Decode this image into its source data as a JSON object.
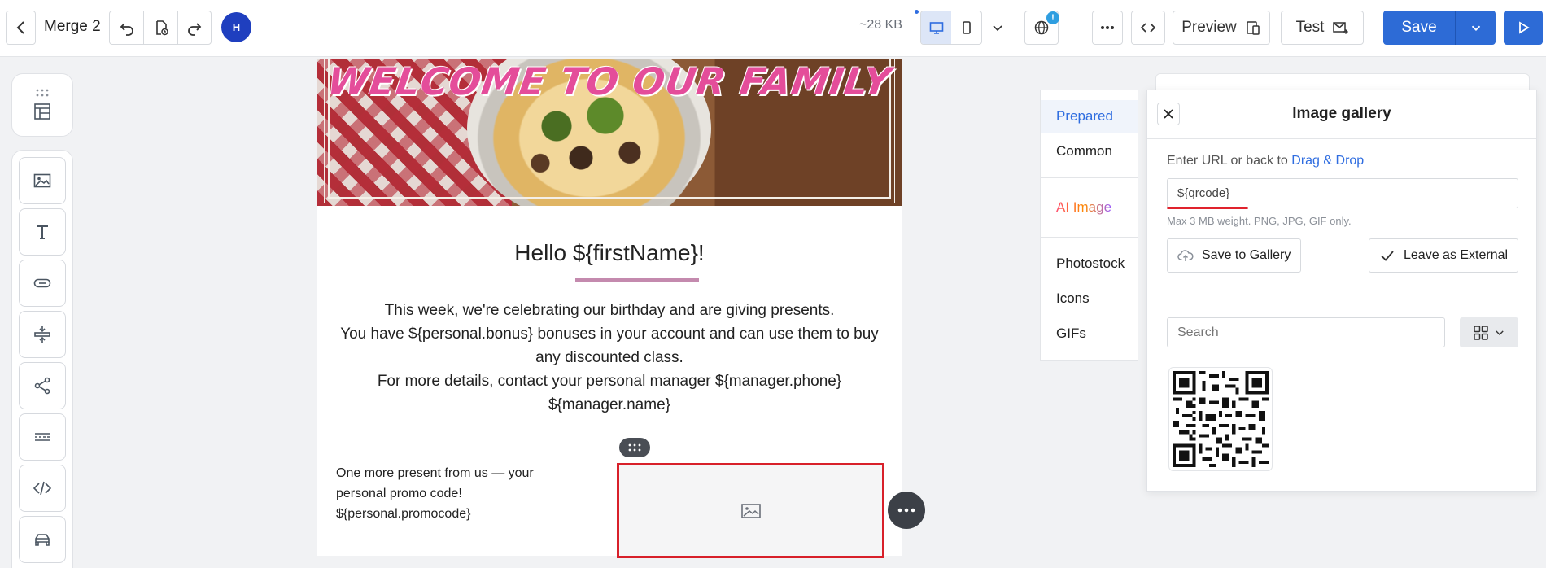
{
  "header": {
    "title": "Merge 2",
    "avatar_initial": "H",
    "size": "~28 KB",
    "preview_label": "Preview",
    "test_label": "Test",
    "save_label": "Save",
    "notification_badge": "!"
  },
  "email": {
    "banner_text": "WELCOME TO OUR FAMILY",
    "greeting": "Hello ${firstName}!",
    "body_lines": [
      "This week, we're celebrating our birthday and are giving presents.",
      "You have ${personal.bonus} bonuses in your account and can use them to buy any discounted class.",
      "For more details, contact your personal manager ${manager.phone} ${manager.name}"
    ],
    "promo_lines": [
      "One more present from us — your personal promo code!",
      "${personal.promocode}"
    ]
  },
  "gallery_categories": {
    "items": [
      {
        "label": "Prepared"
      },
      {
        "label": "Common"
      },
      {
        "label": "AI Image"
      },
      {
        "label": "Photostock"
      },
      {
        "label": "Icons"
      },
      {
        "label": "GIFs"
      }
    ]
  },
  "gallery": {
    "title": "Image gallery",
    "hint_prefix": "Enter URL or back to",
    "hint_link": "Drag & Drop",
    "url_value": "${qrcode}",
    "limit_text": "Max 3 MB weight. PNG, JPG, GIF only.",
    "save_to_gallery_label": "Save to Gallery",
    "leave_external_label": "Leave as External",
    "search_placeholder": "Search"
  },
  "colors": {
    "accent": "#2d6bd6",
    "selection_border": "#d8202a",
    "banner_text": "#e44d9a"
  }
}
